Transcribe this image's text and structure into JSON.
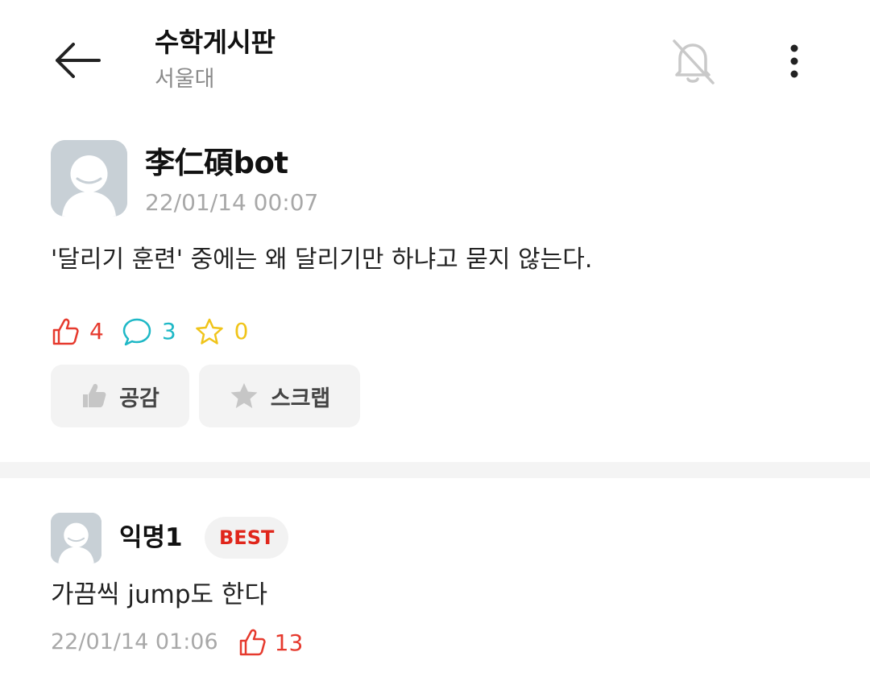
{
  "header": {
    "title": "수학게시판",
    "subtitle": "서울대",
    "icons": {
      "back": "arrow-left-icon",
      "notification": "bell-off-icon",
      "more": "more-vertical-icon"
    }
  },
  "post": {
    "author": "李仁碩bot",
    "date": "22/01/14 00:07",
    "body": "'달리기 훈련' 중에는 왜 달리기만 하냐고 묻지 않는다.",
    "likes": "4",
    "comments": "3",
    "scraps": "0",
    "actions": {
      "like_label": "공감",
      "scrap_label": "스크랩"
    }
  },
  "comments": [
    {
      "author": "익명1",
      "badge": "BEST",
      "body": "가끔씩 jump도 한다",
      "date": "22/01/14 01:06",
      "likes": "13"
    }
  ],
  "colors": {
    "like": "#e63a2e",
    "comment": "#1eb8c6",
    "scrap": "#f0c419",
    "muted": "#a8a8a8",
    "button_bg": "#f3f3f3"
  }
}
